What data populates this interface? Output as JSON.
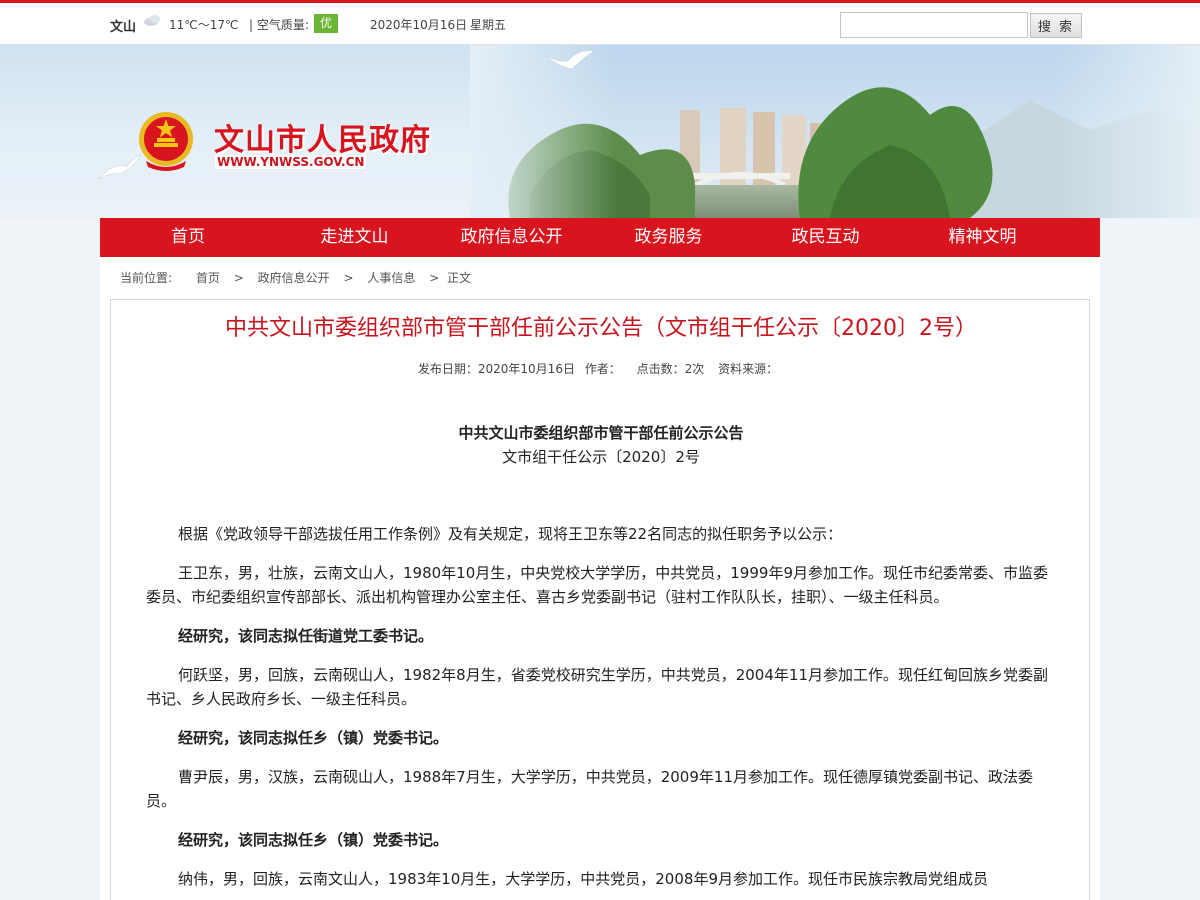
{
  "topbar": {
    "city": "文山",
    "weather_icon": "cloud-icon",
    "temperature": "11℃～17℃",
    "air_quality_label": "| 空气质量:",
    "air_quality_value": "优",
    "date": "2020年10月16日",
    "weekday": "星期五",
    "search_placeholder": "",
    "search_button": "搜 索"
  },
  "header": {
    "site_title": "文山市人民政府",
    "site_url": "WWW.YNWSS.GOV.CN",
    "emblem_icon": "national-emblem-icon"
  },
  "nav": {
    "items": [
      "首页",
      "走进文山",
      "政府信息公开",
      "政务服务",
      "政民互动",
      "精神文明"
    ]
  },
  "breadcrumb": {
    "label": "当前位置:",
    "items": [
      "首页",
      "政府信息公开",
      "人事信息"
    ],
    "current": "正文"
  },
  "article": {
    "title": "中共文山市委组织部市管干部任前公示公告（文市组干任公示〔2020〕2号）",
    "meta": {
      "publish_date": "发布日期：2020年10月16日",
      "author": "作者：",
      "clicks": "点击数：2次",
      "source": "资料来源："
    },
    "doc_heading": "中共文山市委组织部市管干部任前公示公告",
    "doc_number": "文市组干任公示〔2020〕2号",
    "paragraphs": [
      {
        "text": "根据《党政领导干部选拔任用工作条例》及有关规定，现将王卫东等22名同志的拟任职务予以公示：",
        "bold": false
      },
      {
        "text": "王卫东，男，壮族，云南文山人，1980年10月生，中央党校大学学历，中共党员，1999年9月参加工作。现任市纪委常委、市监委委员、市纪委组织宣传部部长、派出机构管理办公室主任、喜古乡党委副书记（驻村工作队队长，挂职）、一级主任科员。",
        "bold": false
      },
      {
        "text": "经研究，该同志拟任街道党工委书记。",
        "bold": true
      },
      {
        "text": "何跃坚，男，回族，云南砚山人，1982年8月生，省委党校研究生学历，中共党员，2004年11月参加工作。现任红甸回族乡党委副书记、乡人民政府乡长、一级主任科员。",
        "bold": false
      },
      {
        "text": "经研究，该同志拟任乡（镇）党委书记。",
        "bold": true
      },
      {
        "text": "曹尹辰，男，汉族，云南砚山人，1988年7月生，大学学历，中共党员，2009年11月参加工作。现任德厚镇党委副书记、政法委员。",
        "bold": false
      },
      {
        "text": "经研究，该同志拟任乡（镇）党委书记。",
        "bold": true
      },
      {
        "text": "纳伟，男，回族，云南文山人，1983年10月生，大学学历，中共党员，2008年9月参加工作。现任市民族宗教局党组成员",
        "bold": false
      }
    ]
  }
}
